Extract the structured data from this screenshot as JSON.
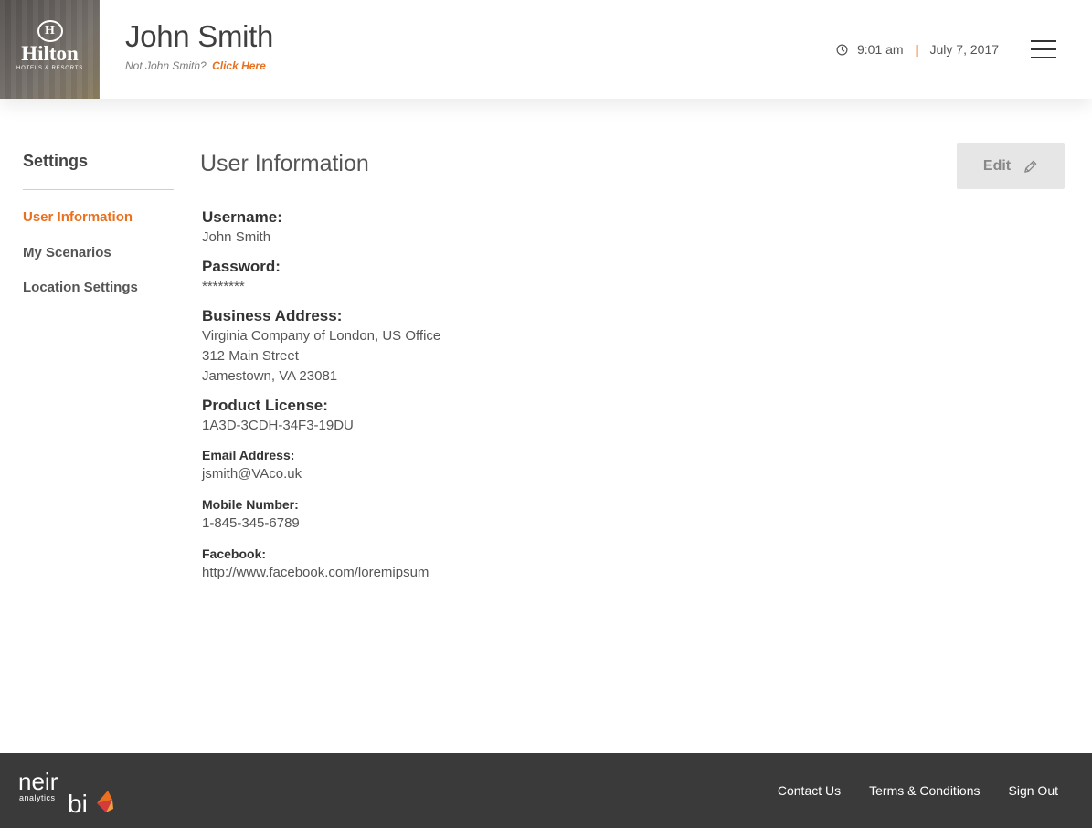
{
  "header": {
    "brand": {
      "mark": "H",
      "name": "Hilton",
      "subtitle": "HOTELS & RESORTS"
    },
    "user_name": "John Smith",
    "not_user_prompt": "Not John Smith?",
    "not_user_link": "Click Here",
    "time": "9:01 am",
    "separator": "|",
    "date": "July 7, 2017"
  },
  "sidebar": {
    "title": "Settings",
    "items": [
      {
        "label": "User Information",
        "active": true
      },
      {
        "label": "My Scenarios",
        "active": false
      },
      {
        "label": "Location Settings",
        "active": false
      }
    ]
  },
  "main": {
    "title": "User Information",
    "edit_label": "Edit",
    "fields": {
      "username": {
        "label": "Username:",
        "value": "John Smith"
      },
      "password": {
        "label": "Password:",
        "value": "********"
      },
      "business_address": {
        "label": "Business Address:",
        "lines": [
          "Virginia Company of London, US Office",
          "312 Main Street",
          "Jamestown, VA 23081"
        ]
      },
      "product_license": {
        "label": "Product License:",
        "value": "1A3D-3CDH-34F3-19DU"
      },
      "email": {
        "label": "Email Address:",
        "value": "jsmith@VAco.uk"
      },
      "mobile": {
        "label": "Mobile Number:",
        "value": "1-845-345-6789"
      },
      "facebook": {
        "label": "Facebook:",
        "value": "http://www.facebook.com/loremipsum"
      }
    }
  },
  "footer": {
    "logo": {
      "word_top": "neir",
      "word_sub": "analytics",
      "word_bottom": "bi"
    },
    "links": [
      "Contact Us",
      "Terms & Conditions",
      "Sign Out"
    ]
  },
  "colors": {
    "accent": "#e8701f",
    "footer_bg": "#3a3a3a",
    "edit_bg": "#e6e6e6"
  },
  "icons": {
    "clock": "clock-icon",
    "menu": "hamburger-menu-icon",
    "edit": "pencil-icon"
  }
}
